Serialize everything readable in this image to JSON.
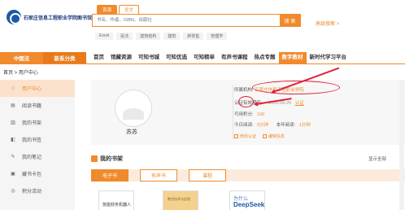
{
  "header": {
    "logo_text": "石家庄信息工程职业学院图书馆",
    "search_tabs": [
      "资源",
      "全文"
    ],
    "search_placeholder": "书名、作者、ISBN、出版社",
    "search_button": "搜 索",
    "advanced_search": "高级搜索 >",
    "hot_tags": [
      "Excel",
      "民法",
      "建筑结构",
      "建筑",
      "新零售",
      "管理学"
    ]
  },
  "nav": {
    "cat_primary": "中图法",
    "cat_secondary": "新系分类",
    "items": [
      "首页",
      "馆藏资源",
      "可知书城",
      "可知优选",
      "可知榜单",
      "有声书课程",
      "热点专题",
      "数字教材",
      "新时代学习平台"
    ],
    "active_index": 7
  },
  "breadcrumb": "首页 > 用户中心",
  "sidebar": {
    "items": [
      {
        "label": "用户中心",
        "icon": "user-icon",
        "glyph": "☺",
        "active": true
      },
      {
        "label": "阅读书籍",
        "icon": "book-icon",
        "glyph": "▤",
        "active": false
      },
      {
        "label": "我的书架",
        "icon": "shelf-icon",
        "glyph": "▥",
        "active": false
      },
      {
        "label": "我的书签",
        "icon": "bookmark-icon",
        "glyph": "◧",
        "active": false
      },
      {
        "label": "我的笔记",
        "icon": "note-icon",
        "glyph": "✎",
        "active": false
      },
      {
        "label": "藏书卡包",
        "icon": "card-icon",
        "glyph": "▣",
        "active": false
      },
      {
        "label": "积分活动",
        "icon": "points-icon",
        "glyph": "◎",
        "active": false
      }
    ]
  },
  "profile": {
    "username": "苏苏",
    "org_label": "所属机构:",
    "org_value": "石家庄信息工程职业学院",
    "expire_label": "认证有效期至:",
    "expire_value": "2026-06-25",
    "auth_link": "认证",
    "points_label": "可用积分:",
    "points_value": "100",
    "today_label": "今日阅读:",
    "today_value": "0分钟",
    "year_label": "本年阅读:",
    "year_value": "1分钟",
    "btn_edit": "修改认证",
    "btn_password": "编辑信息"
  },
  "shelf": {
    "title": "我的书架",
    "show_all": "显示全部",
    "tabs": [
      "电子书",
      "有声书",
      "课程"
    ],
    "active_tab": 0,
    "books": [
      {
        "title": "技能财务机器人"
      },
      {
        "title": "数字技术与应用"
      },
      {
        "title_line1": "为什么",
        "title_line2": "DeepSeek"
      }
    ]
  }
}
